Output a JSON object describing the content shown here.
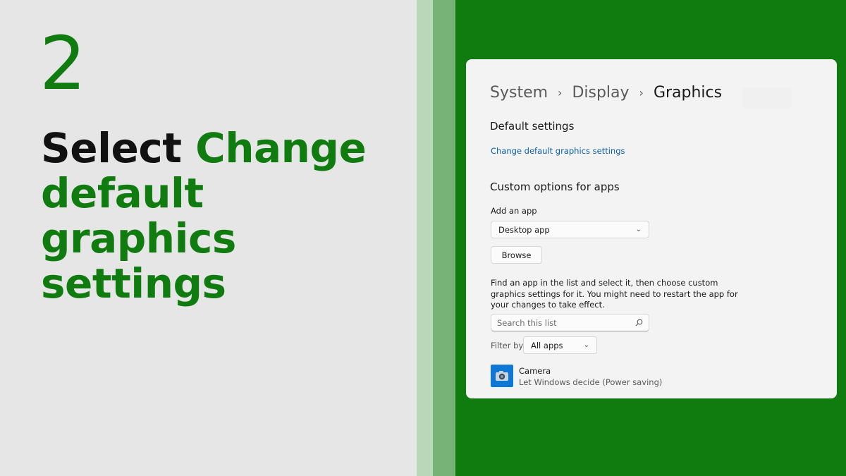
{
  "slide": {
    "step_number": "2",
    "headline_verb": "Select",
    "headline_target": "Change default graphics settings"
  },
  "window": {
    "breadcrumb": [
      "System",
      "Display",
      "Graphics"
    ],
    "default_settings": {
      "title": "Default settings",
      "link": "Change default graphics settings"
    },
    "custom_options": {
      "title": "Custom options for apps",
      "add_app_label": "Add an app",
      "app_type_selected": "Desktop app",
      "browse_label": "Browse",
      "description": "Find an app in the list and select it, then choose custom graphics settings for it. You might need to restart the app for your changes to take effect.",
      "search_placeholder": "Search this list",
      "filter_label": "Filter by:",
      "filter_selected": "All apps"
    },
    "apps": [
      {
        "name": "Camera",
        "status": "Let Windows decide (Power saving)",
        "icon": "camera-icon"
      }
    ]
  },
  "colors": {
    "accent_green": "#107c10",
    "stripe_light": "#b9d7b9",
    "stripe_mid": "#77b277",
    "link_blue": "#0a5ea8",
    "camera_icon_blue": "#0f78d4"
  }
}
